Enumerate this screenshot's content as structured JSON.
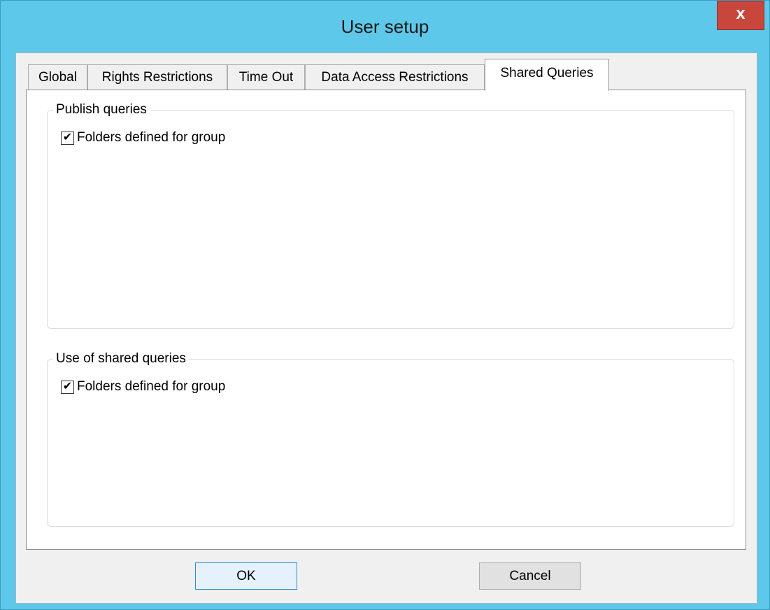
{
  "window": {
    "title": "User setup",
    "close_label": "x"
  },
  "tabs": [
    {
      "label": "Global",
      "active": false
    },
    {
      "label": "Rights Restrictions",
      "active": false
    },
    {
      "label": "Time Out",
      "active": false
    },
    {
      "label": "Data Access Restrictions",
      "active": false
    },
    {
      "label": "Shared Queries",
      "active": true
    }
  ],
  "publish_group": {
    "legend": "Publish queries",
    "checkbox_label": "Folders defined for group",
    "checked": true
  },
  "use_group": {
    "legend": "Use of shared queries",
    "checkbox_label": "Folders defined for group",
    "checked": true
  },
  "buttons": {
    "ok_label": "OK",
    "cancel_label": "Cancel"
  },
  "colors": {
    "titlebar": "#5ec8ea",
    "close_button": "#c9463d",
    "dialog_background": "#f0f0f0",
    "default_button_border": "#2e8fcf"
  }
}
